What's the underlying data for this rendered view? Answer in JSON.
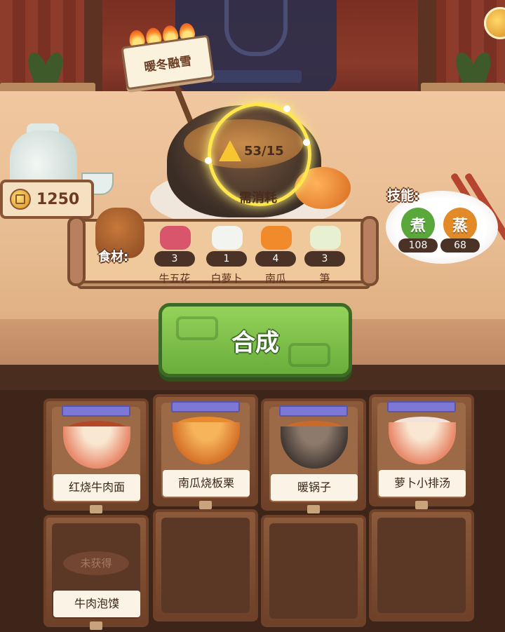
{
  "hud": {
    "coins": "1250"
  },
  "event_sign": {
    "text": "暖冬融雪",
    "flame_count": 4
  },
  "recipe": {
    "progress_text": "53/15",
    "consume_label": "需消耗"
  },
  "ingredients": {
    "label": "食材:",
    "items": [
      {
        "name": "牛五花",
        "count": "3",
        "icon": "pork-belly-icon",
        "color": "#d9556b"
      },
      {
        "name": "白萝卜",
        "count": "1",
        "icon": "radish-icon",
        "color": "#f2f4f0"
      },
      {
        "name": "南瓜",
        "count": "4",
        "icon": "pumpkin-icon",
        "color": "#f08a2a"
      },
      {
        "name": "笋",
        "count": "3",
        "icon": "bamboo-shoot-icon",
        "color": "#e8f0d2"
      }
    ]
  },
  "skills": {
    "label": "技能:",
    "items": [
      {
        "name": "煮",
        "level": "108",
        "color": "#5aa73b"
      },
      {
        "name": "蒸",
        "level": "68",
        "color": "#e38a28"
      }
    ]
  },
  "actions": {
    "synthesize": "合成"
  },
  "dishes": [
    {
      "name": "红烧牛肉面",
      "obtained": true
    },
    {
      "name": "南瓜烧板栗",
      "obtained": true
    },
    {
      "name": "暖锅子",
      "obtained": true
    },
    {
      "name": "萝卜小排汤",
      "obtained": true
    },
    {
      "name": "牛肉泡馍",
      "obtained": false,
      "status": "未获得"
    }
  ]
}
